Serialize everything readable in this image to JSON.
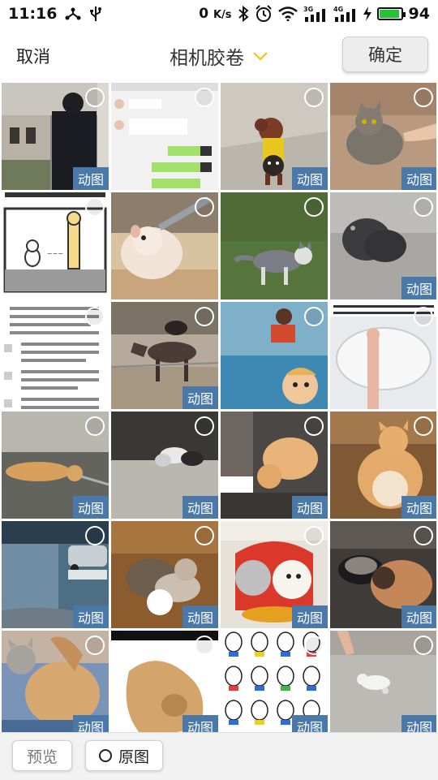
{
  "status_bar": {
    "time": "11:16",
    "net_speed": "0",
    "net_unit": "K/s",
    "battery": "94",
    "battery_level": 0.94,
    "icons": [
      "usb-tree-icon",
      "usb-icon",
      "bluetooth-icon",
      "alarm-icon",
      "wifi-icon",
      "signal-3g-icon",
      "signal-4g-icon",
      "charging-icon",
      "battery-icon"
    ],
    "colors": {
      "battery": "#27c13a"
    }
  },
  "header": {
    "cancel_label": "取消",
    "album_title": "相机胶卷",
    "confirm_label": "确定",
    "dropdown_icon": "chevron-down-icon",
    "accent": "#f4c20d"
  },
  "grid": {
    "gif_badge_label": "动图",
    "badge_color": "#4a79a9",
    "items": [
      {
        "name": "photo-street-man",
        "gif": true
      },
      {
        "name": "photo-chat-screenshot",
        "gif": false
      },
      {
        "name": "photo-dog-costume",
        "gif": true
      },
      {
        "name": "photo-cat-hand",
        "gif": true
      },
      {
        "name": "photo-comic-strip",
        "gif": false
      },
      {
        "name": "photo-hamster-drinking",
        "gif": false
      },
      {
        "name": "photo-husky-grass",
        "gif": false
      },
      {
        "name": "photo-black-cat",
        "gif": true
      },
      {
        "name": "photo-text-screenshot",
        "gif": false
      },
      {
        "name": "photo-donkeys",
        "gif": true
      },
      {
        "name": "photo-kids-collage",
        "gif": false
      },
      {
        "name": "photo-bathtub-hand",
        "gif": false
      },
      {
        "name": "photo-cat-stretching",
        "gif": true
      },
      {
        "name": "photo-dogs-yard",
        "gif": true
      },
      {
        "name": "photo-orange-cat-jump",
        "gif": true
      },
      {
        "name": "photo-fat-orange-cat",
        "gif": true
      },
      {
        "name": "photo-street-cars",
        "gif": true
      },
      {
        "name": "photo-cat-dog-play",
        "gif": true
      },
      {
        "name": "photo-puppies-costume",
        "gif": true
      },
      {
        "name": "photo-puppy-bowl",
        "gif": true
      },
      {
        "name": "photo-cat-and-dog-bed",
        "gif": true
      },
      {
        "name": "photo-dog-closeup",
        "gif": true
      },
      {
        "name": "photo-cartoon-pattern",
        "gif": true
      },
      {
        "name": "photo-kitten-floor",
        "gif": true
      }
    ]
  },
  "bottom_bar": {
    "preview_label": "预览",
    "original_label": "原图"
  }
}
